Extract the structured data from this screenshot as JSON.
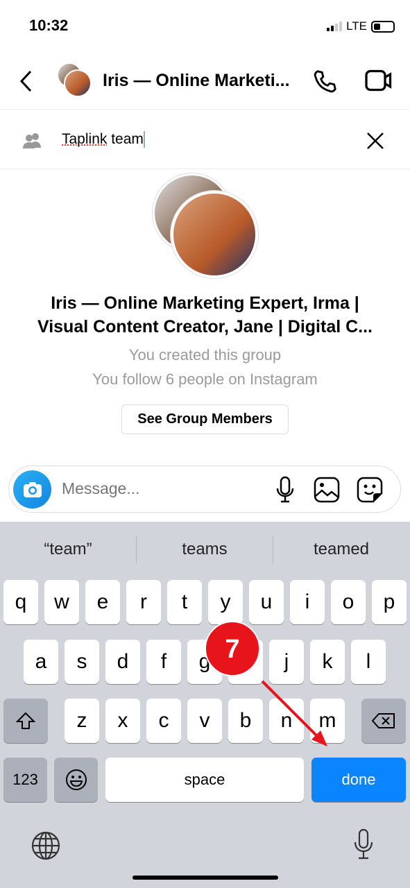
{
  "status": {
    "time": "10:32",
    "network": "LTE",
    "battery_level": 0.25
  },
  "header": {
    "title": "Iris — Online Marketi..."
  },
  "group_name": {
    "value": "Taplink team",
    "misspelled": "Taplink",
    "rest": " team"
  },
  "group": {
    "name_line1": "Iris — Online Marketing Expert, Irma |",
    "name_line2": "Visual Content Creator, Jane | Digital C...",
    "created": "You created this group",
    "follow": "You follow 6 people on Instagram",
    "members_button": "See Group Members"
  },
  "composer": {
    "placeholder": "Message..."
  },
  "keyboard": {
    "suggestions": [
      "“team”",
      "teams",
      "teamed"
    ],
    "row1": [
      "q",
      "w",
      "e",
      "r",
      "t",
      "y",
      "u",
      "i",
      "o",
      "p"
    ],
    "row2": [
      "a",
      "s",
      "d",
      "f",
      "g",
      "h",
      "j",
      "k",
      "l"
    ],
    "row3": [
      "z",
      "x",
      "c",
      "v",
      "b",
      "n",
      "m"
    ],
    "numbers": "123",
    "space": "space",
    "done": "done"
  },
  "annotation": {
    "step": "7",
    "color": "#e8141c"
  },
  "colors": {
    "accent": "#0a84ff"
  }
}
